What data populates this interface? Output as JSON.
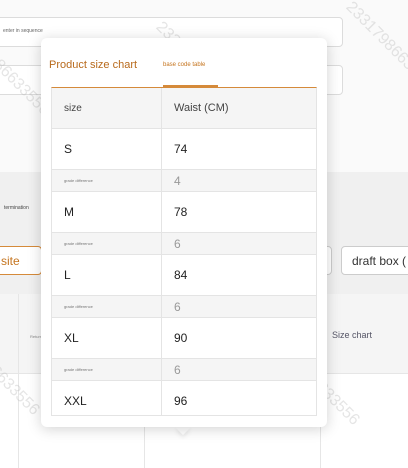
{
  "background": {
    "input_1_text": "enter in sequence",
    "termination_label": "termination",
    "site_button_label": "site",
    "draft_button_label": "draft box (",
    "return_label": "Return",
    "size_chart_header": "Size chart",
    "watermark": "23317986633556"
  },
  "popover": {
    "tabs": [
      {
        "label": "Product size chart",
        "active": false
      },
      {
        "label": "base code table",
        "active": true
      }
    ],
    "table": {
      "headers": [
        "size",
        "Waist (CM)"
      ],
      "rows": [
        {
          "kind": "size",
          "label": "S",
          "value": "74"
        },
        {
          "kind": "diff",
          "label": "grade difference",
          "value": "4"
        },
        {
          "kind": "size",
          "label": "M",
          "value": "78"
        },
        {
          "kind": "diff",
          "label": "grade difference",
          "value": "6"
        },
        {
          "kind": "size",
          "label": "L",
          "value": "84"
        },
        {
          "kind": "diff",
          "label": "grade difference",
          "value": "6"
        },
        {
          "kind": "size",
          "label": "XL",
          "value": "90"
        },
        {
          "kind": "diff",
          "label": "grade difference",
          "value": "6"
        },
        {
          "kind": "size",
          "label": "XXL",
          "value": "96"
        }
      ]
    }
  },
  "colors": {
    "accent": "#d58a3a",
    "accent_text": "#b86a1c"
  }
}
